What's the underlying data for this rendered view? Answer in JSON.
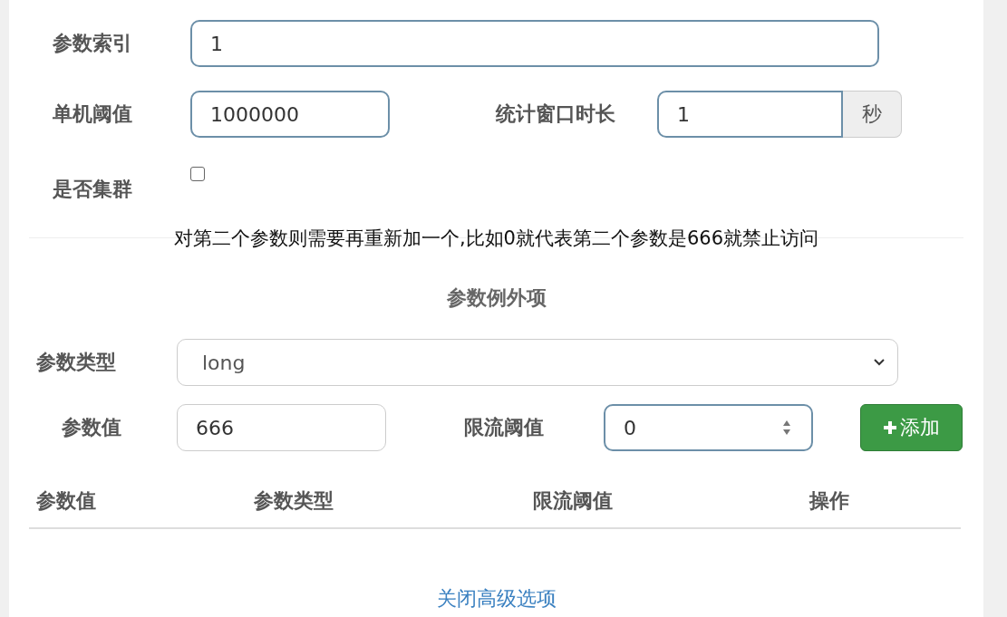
{
  "rule": {
    "param_index": {
      "label": "参数索引",
      "value": "1"
    },
    "threshold": {
      "label": "单机阈值",
      "value": "1000000"
    },
    "window": {
      "label": "统计窗口时长",
      "value": "1",
      "unit": "秒"
    },
    "cluster": {
      "label": "是否集群",
      "checked": false
    }
  },
  "caption": "对第二个参数则需要再重新加一个,比如0就代表第二个参数是666就禁止访问",
  "exceptions": {
    "title": "参数例外项",
    "param_type": {
      "label": "参数类型",
      "value": "long"
    },
    "param_value": {
      "label": "参数值",
      "value": "666"
    },
    "limit": {
      "label": "限流阈值",
      "value": "0"
    },
    "add_button": "添加"
  },
  "table": {
    "columns": [
      "参数值",
      "参数类型",
      "限流阈值",
      "操作"
    ]
  },
  "toggle_link": "关闭高级选项"
}
